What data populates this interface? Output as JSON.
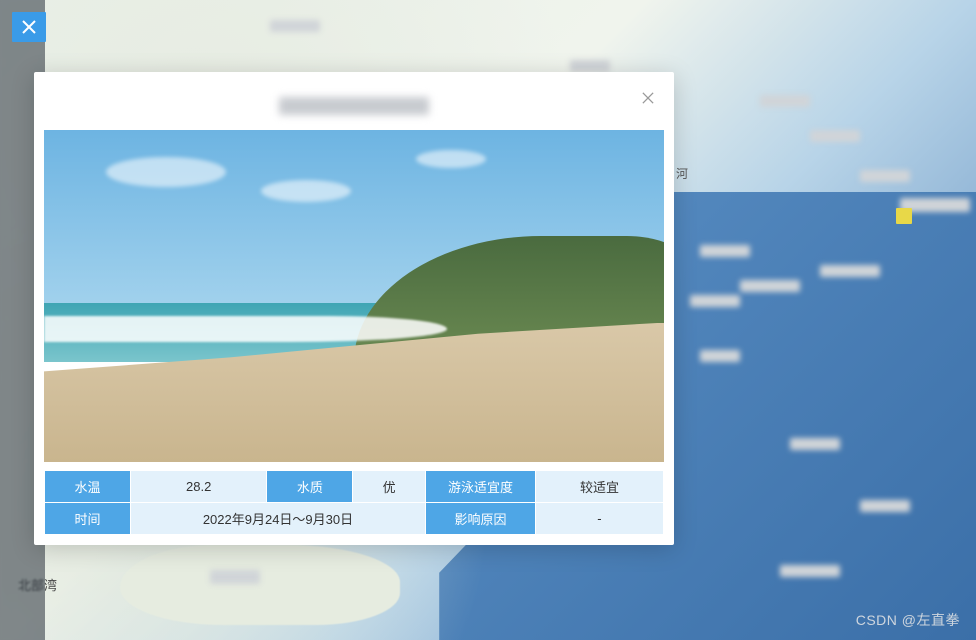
{
  "map": {
    "bay_label": "北部湾",
    "river_suffix": "河"
  },
  "modal": {
    "fields": {
      "water_temp": {
        "label": "水温",
        "value": "28.2"
      },
      "water_quality": {
        "label": "水质",
        "value": "优"
      },
      "swim_suitability": {
        "label": "游泳适宜度",
        "value": "较适宜"
      },
      "time": {
        "label": "时间",
        "value": "2022年9月24日～9月30日"
      },
      "reason": {
        "label": "影响原因",
        "value": "-"
      }
    }
  },
  "watermark": "CSDN @左直拳"
}
